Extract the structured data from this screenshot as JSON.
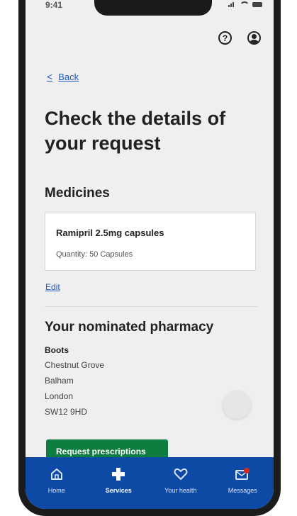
{
  "status_bar": {
    "time": "9:41"
  },
  "header": {
    "help_symbol": "?"
  },
  "back": {
    "chevron": "<",
    "label": "Back"
  },
  "page": {
    "title": "Check the details of your request"
  },
  "medicines": {
    "title": "Medicines",
    "item": {
      "name": "Ramipril 2.5mg capsules",
      "quantity": "Quantity: 50 Capsules"
    },
    "edit_label": "Edit"
  },
  "pharmacy": {
    "title": "Your nominated pharmacy",
    "name": "Boots",
    "address": [
      "Chestnut Grove",
      "Balham",
      "London",
      "SW12 9HD"
    ]
  },
  "actions": {
    "request_label": "Request prescriptions"
  },
  "tab_bar": {
    "tabs": [
      {
        "label": "Home",
        "icon": "home-icon"
      },
      {
        "label": "Services",
        "icon": "plus-icon",
        "active": true
      },
      {
        "label": "Your health",
        "icon": "heart-icon"
      },
      {
        "label": "Messages",
        "icon": "message-icon"
      }
    ]
  },
  "colors": {
    "link": "#1d5bbf",
    "primary_button": "#0f7c40",
    "tab_bar": "#0d4aa6"
  }
}
